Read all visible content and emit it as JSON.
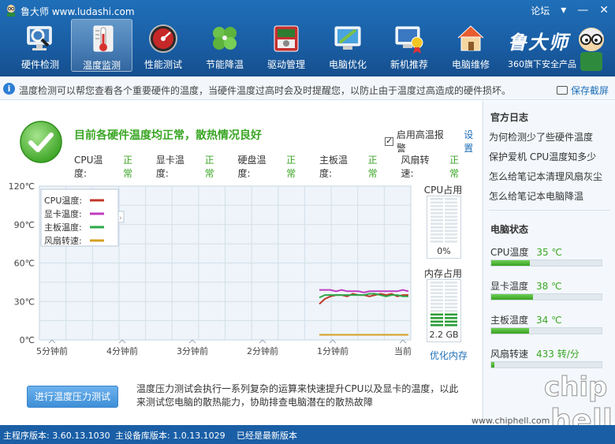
{
  "window": {
    "title": "鲁大师 www.ludashi.com",
    "controls": [
      "论坛",
      "▾",
      "—",
      "✕"
    ]
  },
  "toolbar": [
    {
      "label": "硬件检测",
      "icon": "monitor-magnifier-icon"
    },
    {
      "label": "温度监测",
      "icon": "thermometer-icon",
      "active": true
    },
    {
      "label": "性能测试",
      "icon": "speedometer-icon"
    },
    {
      "label": "节能降温",
      "icon": "clover-icon"
    },
    {
      "label": "驱动管理",
      "icon": "driver-chip-icon"
    },
    {
      "label": "电脑优化",
      "icon": "broom-screen-icon"
    },
    {
      "label": "新机推荐",
      "icon": "medal-monitor-icon"
    },
    {
      "label": "电脑维修",
      "icon": "house-icon"
    }
  ],
  "brand": {
    "title": "鲁大师",
    "subtitle": "360旗下安全产品"
  },
  "info": {
    "text": "温度检测可以帮您查看各个重要硬件的温度，当硬件温度过高时会及时提醒您，以防止由于温度过高造成的硬件损坏。",
    "screenshot_label": "保存截屏"
  },
  "status": {
    "headline": "目前各硬件温度均正常，散热情况良好",
    "alarm_label": "启用高温报警",
    "alarm_checked": true,
    "settings_label": "设置",
    "items": [
      {
        "name": "CPU温度:",
        "state": "正常"
      },
      {
        "name": "显卡温度:",
        "state": "正常"
      },
      {
        "name": "硬盘温度:",
        "state": "正常"
      },
      {
        "name": "主板温度:",
        "state": "正常"
      },
      {
        "name": "风扇转速:",
        "state": "正常"
      }
    ]
  },
  "chart_data": {
    "type": "line",
    "y_tick_labels": [
      "120℃",
      "90℃",
      "60℃",
      "30℃",
      "0℃"
    ],
    "ylim": [
      0,
      120
    ],
    "x_tick_labels": [
      "5分钟前",
      "4分钟前",
      "3分钟前",
      "2分钟前",
      "1分钟前",
      "当前"
    ],
    "grid": true,
    "legend_position": "top-left",
    "series": [
      {
        "name": "CPU温度:",
        "color": "#c0392b",
        "values": [
          28,
          32,
          34,
          35,
          35,
          34,
          36,
          35,
          35,
          34,
          35,
          36,
          35,
          36,
          34,
          35,
          35
        ]
      },
      {
        "name": "显卡温度:",
        "color": "#c03cc0",
        "values": [
          39,
          39,
          39,
          38,
          39,
          38,
          38,
          38,
          37,
          38,
          38,
          38,
          38,
          38,
          38,
          39,
          38
        ]
      },
      {
        "name": "主板温度:",
        "color": "#2ea84a",
        "values": [
          33,
          35,
          35,
          35,
          35,
          35,
          35,
          35,
          35,
          36,
          36,
          35,
          34,
          35,
          35,
          34,
          34
        ]
      },
      {
        "name": "风扇转速:",
        "color": "#d4a022",
        "values": [
          4,
          4,
          4,
          4,
          4,
          4,
          4,
          4,
          4,
          4,
          4,
          4,
          4,
          4,
          4,
          4,
          4
        ]
      }
    ]
  },
  "cpu_usage": {
    "title": "CPU占用",
    "value": "0%",
    "level": 0.0
  },
  "mem_usage": {
    "title": "内存占用",
    "value": "2.2 GB",
    "level": 0.28
  },
  "optimize_mem_label": "优化内存",
  "stress_test": {
    "button_label": "进行温度压力测试",
    "description": "温度压力测试会执行一系列复杂的运算来快速提升CPU以及显卡的温度，以此来测试您电脑的散热能力，协助排查电脑潜在的散热故障"
  },
  "sidebar": {
    "log_title": "官方日志",
    "links": [
      "为何检测少了些硬件温度",
      "保护爱机 CPU温度知多少",
      "怎么给笔记本清理风扇灰尘",
      "怎么给笔记本电脑降温"
    ],
    "pc_status_title": "电脑状态",
    "stats": [
      {
        "name": "CPU温度",
        "value": "35 ℃",
        "level": 0.35
      },
      {
        "name": "显卡温度",
        "value": "38 ℃",
        "level": 0.38
      },
      {
        "name": "主板温度",
        "value": "34 ℃",
        "level": 0.34
      },
      {
        "name": "风扇转速",
        "value": "433 转/分",
        "level": 0.03
      }
    ]
  },
  "statusbar": {
    "program_version": "主程序版本: 3.60.13.1030",
    "db_version": "主设备库版本: 1.0.13.1029",
    "update_state": "已经是最新版本"
  },
  "watermark": {
    "url": "www.chiphell.com",
    "text": "chip hell"
  }
}
